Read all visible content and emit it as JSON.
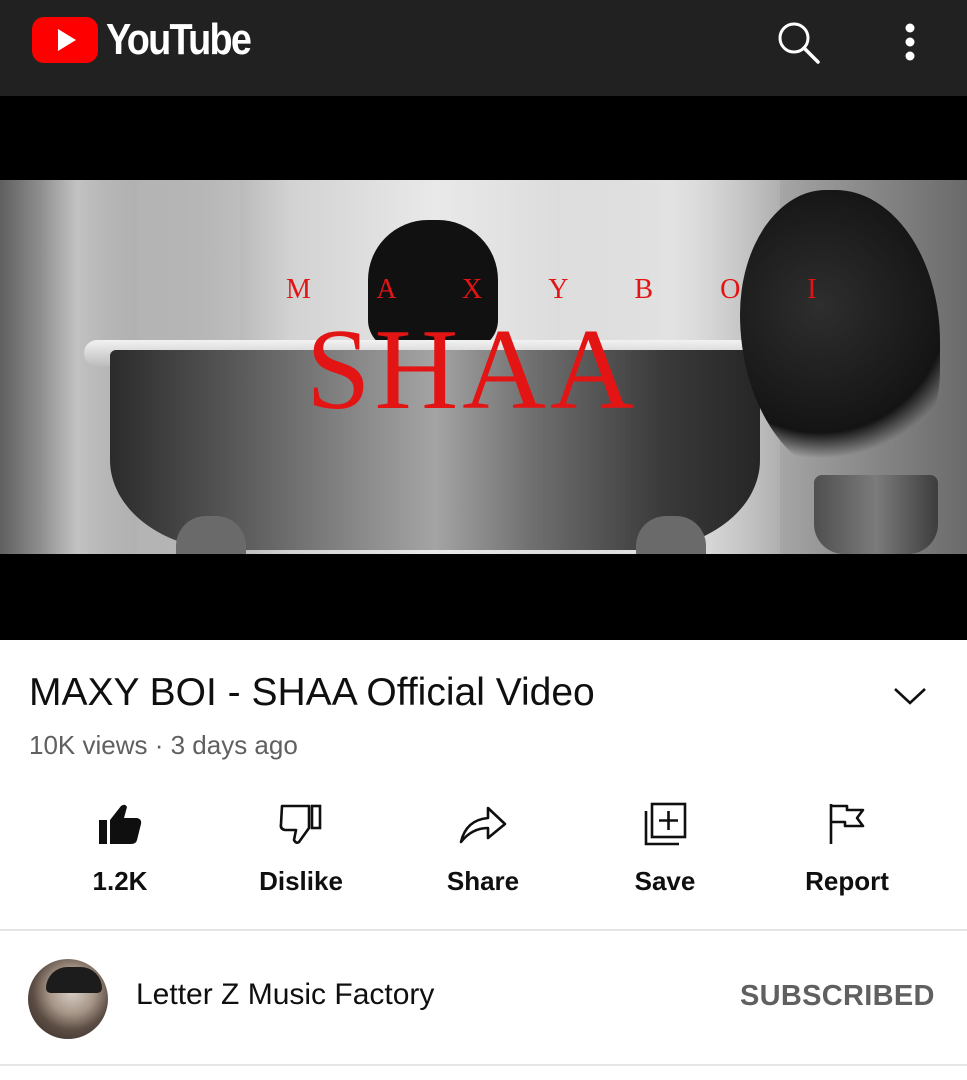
{
  "app": {
    "logo_text": "YouTube"
  },
  "video": {
    "overlay_artist": "M A X Y   B O I",
    "overlay_song": "SHAA",
    "title": "MAXY BOI - SHAA Official Video",
    "meta": "10K views · 3 days ago"
  },
  "actions": {
    "like_count": "1.2K",
    "dislike_label": "Dislike",
    "share_label": "Share",
    "save_label": "Save",
    "report_label": "Report"
  },
  "channel": {
    "name": "Letter Z Music Factory",
    "subscribe_state": "SUBSCRIBED"
  },
  "icons": {
    "logo": "youtube-logo-icon",
    "search": "search-icon",
    "more": "more-vert-icon",
    "expand": "chevron-down-icon",
    "like": "thumb-up-icon",
    "dislike": "thumb-down-icon",
    "share": "share-arrow-icon",
    "save": "playlist-add-icon",
    "report": "flag-icon"
  },
  "colors": {
    "topbar": "#212121",
    "brand_red": "#ff0000",
    "overlay_text": "#e31414",
    "secondary_text": "#606060"
  }
}
